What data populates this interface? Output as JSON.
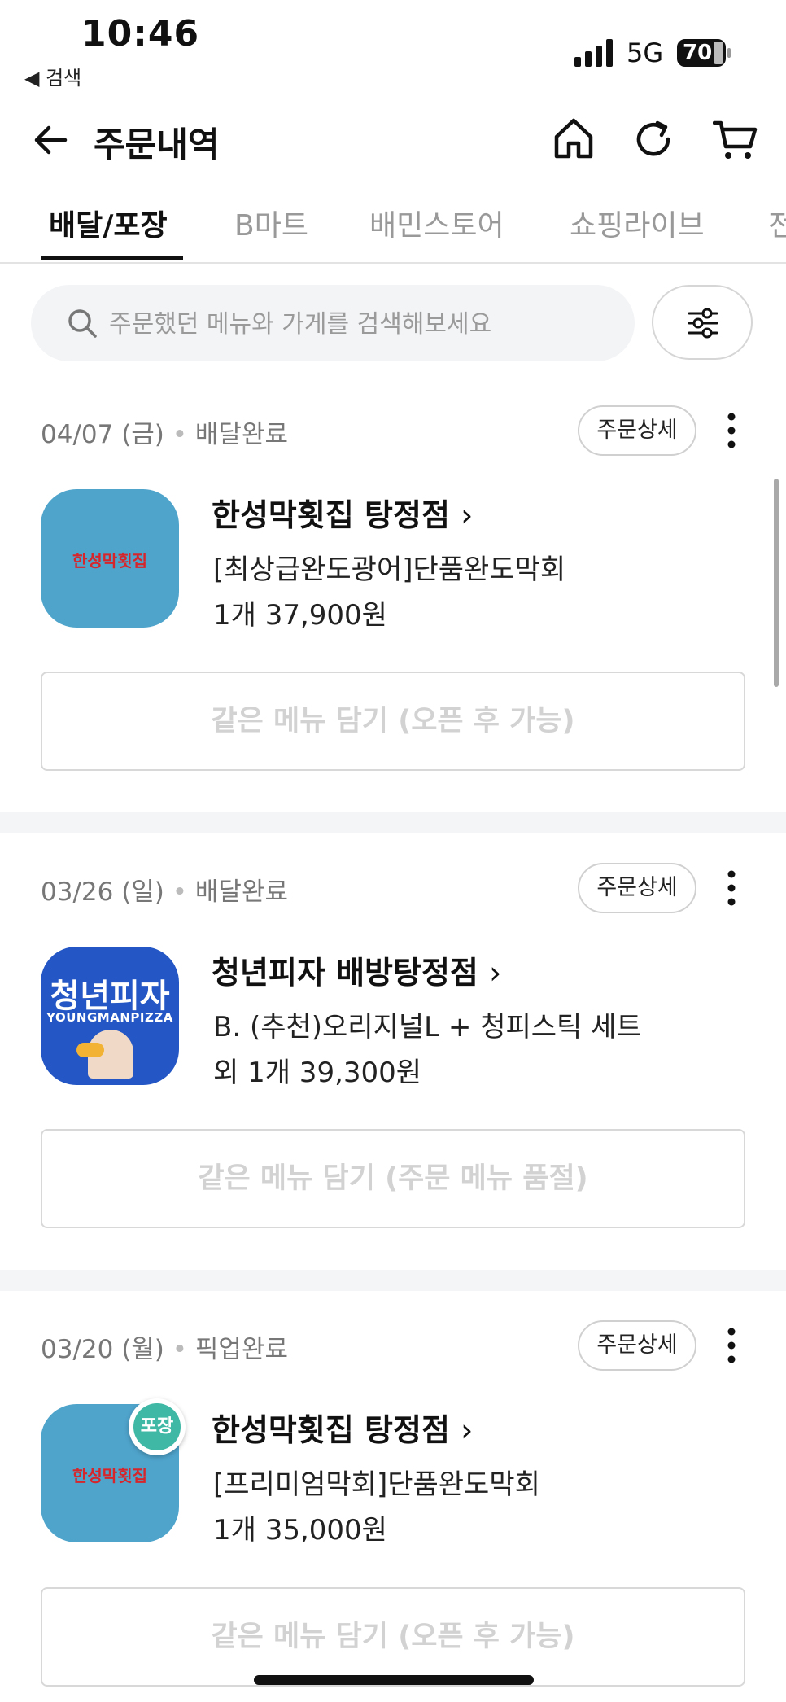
{
  "status_bar": {
    "time": "10:46",
    "back_app": "◀ 검색",
    "network": "5G",
    "battery": "70"
  },
  "header": {
    "title": "주문내역"
  },
  "tabs": [
    {
      "label": "배달/포장",
      "active": true
    },
    {
      "label": "B마트",
      "active": false
    },
    {
      "label": "배민스토어",
      "active": false
    },
    {
      "label": "쇼핑라이브",
      "active": false
    },
    {
      "label": "전",
      "active": false
    }
  ],
  "search": {
    "placeholder": "주문했던 메뉴와 가게를 검색해보세요"
  },
  "orders": [
    {
      "date": "04/07 (금)",
      "status": "배달완료",
      "detail_label": "주문상세",
      "store": "한성막횟집 탕정점",
      "menu": "[최상급완도광어]단품완도막회",
      "summary": "1개 37,900원",
      "reorder_label": "같은 메뉴 담기 (오픈 후 가능)",
      "logo_text": "한성막횟집",
      "logo_mid": "막"
    },
    {
      "date": "03/26 (일)",
      "status": "배달완료",
      "detail_label": "주문상세",
      "store": "청년피자 배방탕정점",
      "menu": "B. (추천)오리지널L + 청피스틱 세트",
      "summary": "외 1개 39,300원",
      "reorder_label": "같은 메뉴 담기 (주문 메뉴 품절)",
      "logo_title": "청년피자",
      "logo_sub": "YOUNGMANPIZZA"
    },
    {
      "date": "03/20 (월)",
      "status": "픽업완료",
      "detail_label": "주문상세",
      "store": "한성막횟집 탕정점",
      "menu": "[프리미엄막회]단품완도막회",
      "summary": "1개 35,000원",
      "reorder_label": "같은 메뉴 담기 (오픈 후 가능)",
      "logo_text": "한성막횟집",
      "logo_mid": "막",
      "badge": "포장"
    }
  ],
  "colors": {
    "logo_blue": "#4fa4cc",
    "pizza_blue": "#2457c5",
    "logo_red": "#d6262b"
  }
}
